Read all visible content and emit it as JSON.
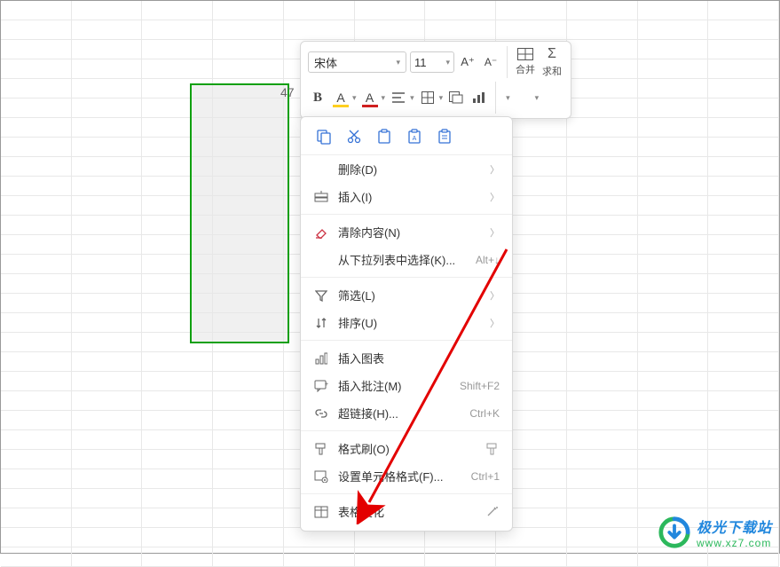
{
  "cell_value": "47",
  "toolbar": {
    "font_name": "宋体",
    "font_size": "11",
    "merge_label": "合并",
    "sum_label": "求和"
  },
  "context_menu": {
    "delete": "删除(D)",
    "insert": "插入(I)",
    "clear": "清除内容(N)",
    "dropdown_select": "从下拉列表中选择(K)...",
    "dropdown_shortcut": "Alt+↓",
    "filter": "筛选(L)",
    "sort": "排序(U)",
    "insert_chart": "插入图表",
    "insert_comment": "插入批注(M)",
    "comment_shortcut": "Shift+F2",
    "hyperlink": "超链接(H)...",
    "hyperlink_shortcut": "Ctrl+K",
    "format_painter": "格式刷(O)",
    "cell_format": "设置单元格格式(F)...",
    "cell_format_shortcut": "Ctrl+1",
    "table_beautify": "表格美化"
  },
  "watermark": {
    "title": "极光下载站",
    "url": "www.xz7.com"
  }
}
